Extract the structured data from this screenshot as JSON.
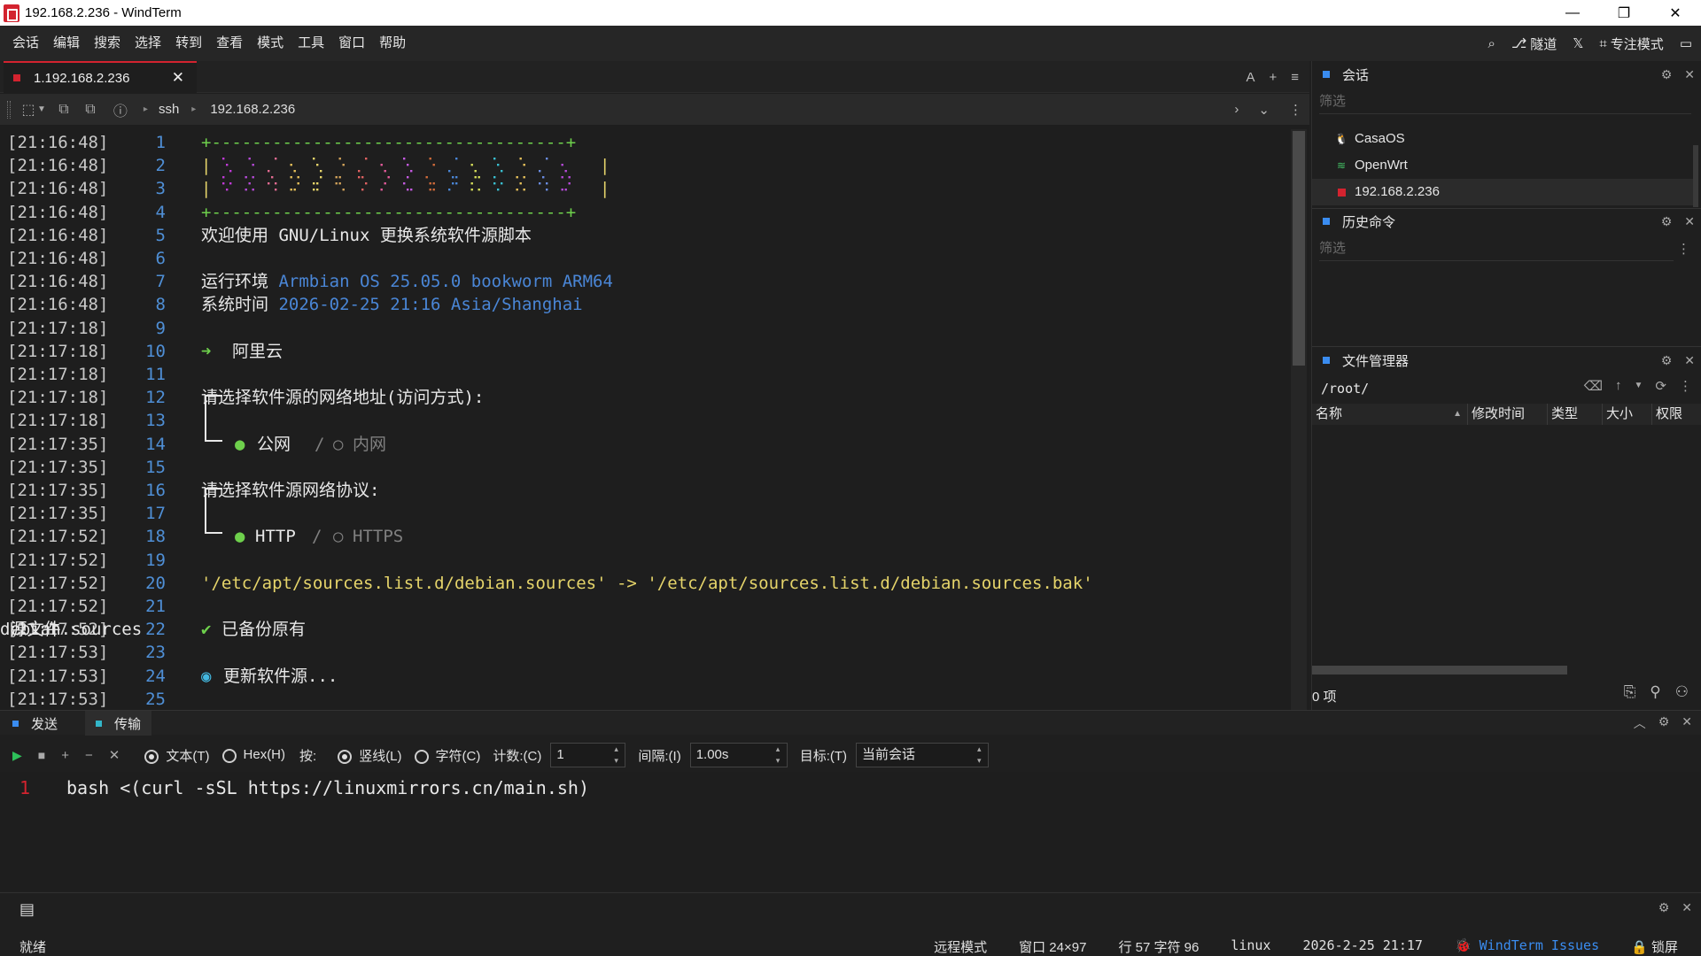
{
  "window": {
    "title": "192.168.2.236 - WindTerm"
  },
  "menu": [
    "会话",
    "编辑",
    "搜索",
    "选择",
    "转到",
    "查看",
    "模式",
    "工具",
    "窗口",
    "帮助"
  ],
  "menu_right": {
    "tunnel": "隧道",
    "focus": "专注模式"
  },
  "tab": {
    "label": "1.192.168.2.236"
  },
  "address": {
    "protocol": "ssh",
    "host": "192.168.2.236"
  },
  "terminal": {
    "timestamps": [
      "[21:16:48]",
      "[21:16:48]",
      "[21:16:48]",
      "[21:16:48]",
      "[21:16:48]",
      "[21:16:48]",
      "[21:16:48]",
      "[21:16:48]",
      "[21:17:18]",
      "[21:17:18]",
      "[21:17:18]",
      "[21:17:18]",
      "[21:17:18]",
      "[21:17:35]",
      "[21:17:35]",
      "[21:17:35]",
      "[21:17:35]",
      "[21:17:52]",
      "[21:17:52]",
      "[21:17:52]",
      "[21:17:52]",
      "[21:17:52]",
      "[21:17:53]",
      "[21:17:53]",
      "[21:17:53]"
    ],
    "line_numbers": [
      "1",
      "2",
      "3",
      "4",
      "5",
      "6",
      "7",
      "8",
      "9",
      "10",
      "11",
      "12",
      "13",
      "14",
      "15",
      "16",
      "17",
      "18",
      "19",
      "20",
      "21",
      "22",
      "23",
      "24",
      "25"
    ],
    "border": "+-----------------------------------+",
    "logo_bar": "|",
    "welcome_pre": "欢迎使用 ",
    "welcome_mid": "GNU/Linux",
    "welcome_post": " 更换系统软件源脚本",
    "env_label": "运行环境 ",
    "env_value": "Armbian OS 25.05.0 bookworm ARM64",
    "time_label": "系统时间 ",
    "time_value": "2026-02-25 21:16 Asia/Shanghai",
    "arrow": "➜",
    "mirror": "阿里云",
    "q1": "请选择软件源的网络地址(访问方式):",
    "q1_sel": "公网",
    "q1_sep": "/",
    "q1_alt": "内网",
    "q2": "请选择软件源网络协议:",
    "q2_sel": "HTTP",
    "q2_sep": "/",
    "q2_alt": "HTTPS",
    "backup_cmd": "'/etc/apt/sources.list.d/debian.sources' -> '/etc/apt/sources.list.d/debian.sources.bak'",
    "check": "✔",
    "backup_msg_pre": "已备份原有 ",
    "backup_msg_mid": "debian.sources",
    "backup_msg_post": " 源文件",
    "update_icon": "◉",
    "update_msg": "更新软件源..."
  },
  "panels": {
    "sessions": {
      "title": "会话",
      "filter": "筛选",
      "items": [
        "CasaOS",
        "OpenWrt",
        "192.168.2.236"
      ]
    },
    "history": {
      "title": "历史命令",
      "filter": "筛选"
    },
    "files": {
      "title": "文件管理器",
      "path": "/root/",
      "columns": [
        "名称",
        "修改时间",
        "类型",
        "大小",
        "权限"
      ],
      "count": "0 项"
    }
  },
  "bottom": {
    "tabs": [
      "发送",
      "传输"
    ],
    "toolbar": {
      "text_mode": "文本(T)",
      "hex_mode": "Hex(H)",
      "by": "按:",
      "line_mode": "竖线(L)",
      "char_mode": "字符(C)",
      "count_label": "计数:(C)",
      "count_value": "1",
      "interval_label": "间隔:(I)",
      "interval_value": "1.00s",
      "target_label": "目标:(T)",
      "target_value": "当前会话"
    },
    "editor": {
      "line": "1",
      "command": "bash <(curl -sSL https://linuxmirrors.cn/main.sh)"
    }
  },
  "status": {
    "ready": "就绪",
    "remote": "远程模式",
    "window_size": "窗口 24×97",
    "cursor": "行 57 字符 96",
    "os": "linux",
    "datetime": "2026-2-25 21:17",
    "issues": "WindTerm Issues",
    "lock": "锁屏"
  },
  "colors": {
    "accent_red": "#d3232f",
    "accent_blue": "#3a8cf0",
    "term_yellow": "#e5d46a",
    "term_blue": "#4a86d6",
    "term_green": "#6ed04c"
  }
}
